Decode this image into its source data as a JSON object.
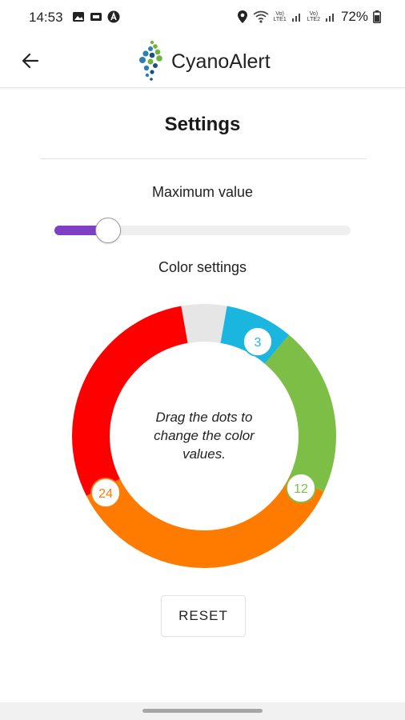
{
  "status_bar": {
    "time": "14:53",
    "battery_percent": "72%",
    "sim1_label_top": "Vo)",
    "sim1_label_bottom": "LTE1",
    "sim2_label_top": "Vo)",
    "sim2_label_bottom": "LTE2",
    "left_icons": [
      "image-icon",
      "cast-icon",
      "vpn-a-icon"
    ],
    "right_icons": [
      "location-icon",
      "wifi-icon",
      "signal-icon",
      "signal-icon",
      "battery-icon"
    ]
  },
  "app_bar": {
    "title": "CyanoAlert",
    "back_icon": "back-arrow-icon",
    "logo_colors": [
      "#2a7fb8",
      "#6fb33c",
      "#1a4e8a"
    ]
  },
  "settings": {
    "title": "Settings",
    "max_value_label": "Maximum value",
    "slider_level_fraction": 0.18,
    "slider_accent": "#7e3fc4",
    "color_settings_label": "Color settings",
    "hint": "Drag the dots to change the color values.",
    "reset_label": "RESET"
  },
  "color_ring": {
    "segments": [
      {
        "name": "empty",
        "color": "#e6e6e6"
      },
      {
        "name": "blue",
        "color": "#1ab6e0"
      },
      {
        "name": "green",
        "color": "#7cbe46"
      },
      {
        "name": "orange",
        "color": "#ff7b00"
      },
      {
        "name": "red",
        "color": "#ff0000"
      }
    ],
    "handles": [
      {
        "value": "3",
        "color": "#1ab6e0"
      },
      {
        "value": "12",
        "color": "#7cbe46"
      },
      {
        "value": "24",
        "color": "#ff7b00"
      }
    ]
  }
}
